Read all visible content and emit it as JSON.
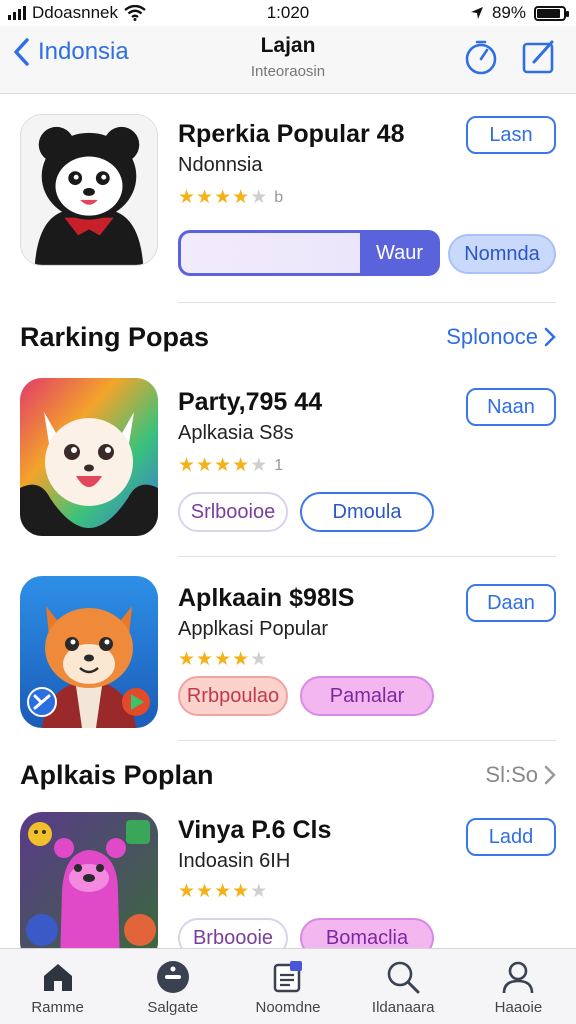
{
  "status_bar": {
    "carrier": "Ddoasnnek",
    "time": "1:020",
    "battery": "89%",
    "battery_level": 0.89
  },
  "nav": {
    "back_label": "Indonsia",
    "title": "Lajan",
    "subtitle": "Inteoraosin"
  },
  "featured": {
    "name": "Rperkia Popular 48",
    "subtitle": "Ndonnsia",
    "rating": 4,
    "rating_count": "b",
    "get_label": "Lasn",
    "progress_label": "Waur",
    "progress": 0.7,
    "secondary_label": "Nomnda"
  },
  "section1": {
    "title": "Rarking Popas",
    "link": "Splonoce"
  },
  "apps": [
    {
      "name": "Party,795 44",
      "subtitle": "Aplkasia S8s",
      "rating": 4,
      "rating_count": "1",
      "get_label": "Naan",
      "pill_a": "Srlbooioe",
      "pill_b": "Dmoula"
    },
    {
      "name": "Aplkaain $98IS",
      "subtitle": "Applkasi Popular",
      "rating": 4,
      "rating_count": "",
      "get_label": "Daan",
      "pill_a": "Rrbpoulao",
      "pill_b": "Pamalar"
    }
  ],
  "section2": {
    "title": "Aplkais Poplan",
    "link": "Sl:So"
  },
  "app4": {
    "name": "Vinya P.6 Cls",
    "subtitle": "Indoasin 6IH",
    "rating": 4,
    "get_label": "Ladd",
    "pill_a": "Brboooie",
    "pill_b": "Bomaclia"
  },
  "tabs": [
    {
      "label": "Ramme",
      "icon": "home-icon"
    },
    {
      "label": "Salgate",
      "icon": "games-icon"
    },
    {
      "label": "Noomdne",
      "icon": "apps-icon"
    },
    {
      "label": "Ildanaara",
      "icon": "search-icon"
    },
    {
      "label": "Haaoie",
      "icon": "profile-icon"
    }
  ],
  "colors": {
    "accent": "#2f6fe3",
    "star": "#f4b21a",
    "progress": "#5b63dc"
  }
}
